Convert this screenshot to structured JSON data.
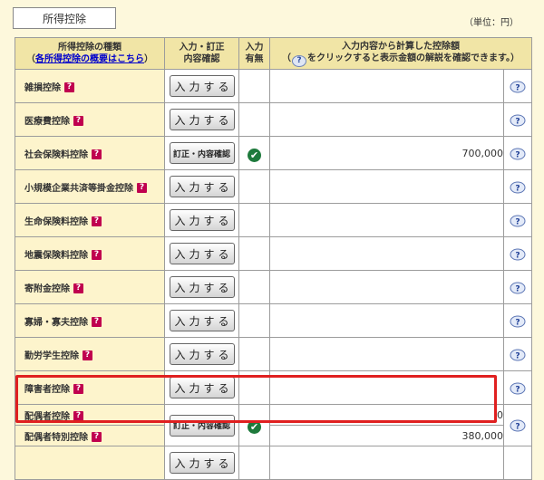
{
  "top_tab": "所得控除",
  "unit_note": "（単位：円）",
  "header": {
    "col_type_line1": "所得控除の種類",
    "col_type_link_prefix": "（",
    "col_type_link": "各所得控除の概要はこちら",
    "col_type_link_suffix": "）",
    "col_input_line1": "入力・訂正",
    "col_input_line2": "内容確認",
    "col_status_line1": "入力",
    "col_status_line2": "有無",
    "col_amount_line1": "入力内容から計算した控除額",
    "col_amount_pre": "（",
    "col_amount_icon": "?",
    "col_amount_post": "をクリックすると表示金額の解説を確認できます。）"
  },
  "help_badge": "?",
  "check_glyph": "✔",
  "rows": [
    {
      "name": "雑損控除",
      "button": "入力する",
      "amount": ""
    },
    {
      "name": "医療費控除",
      "button": "入力する",
      "amount": ""
    },
    {
      "name": "社会保険料控除",
      "button": "訂正・内容確認",
      "amount": "700,000"
    },
    {
      "name": "小規模企業共済等掛金控除",
      "button": "入力する",
      "amount": ""
    },
    {
      "name": "生命保険料控除",
      "button": "入力する",
      "amount": ""
    },
    {
      "name": "地震保険料控除",
      "button": "入力する",
      "amount": ""
    },
    {
      "name": "寄附金控除",
      "button": "入力する",
      "amount": ""
    },
    {
      "name": "寡婦・寡夫控除",
      "button": "入力する",
      "amount": ""
    },
    {
      "name": "勤労学生控除",
      "button": "入力する",
      "amount": ""
    },
    {
      "name": "障害者控除",
      "button": "入力する",
      "amount": ""
    }
  ],
  "spouse": {
    "name1": "配偶者控除",
    "name2": "配偶者特別控除",
    "button": "訂正・内容確認",
    "amount1": "0",
    "amount2": "380,000"
  },
  "partial_button": "入力する",
  "colors": {
    "background": "#fdf8dc",
    "header_bg": "#f1e5a6",
    "help_badge": "#c0004f",
    "check": "#1e7a3c",
    "highlight": "#e02020",
    "link": "#0000cc"
  }
}
